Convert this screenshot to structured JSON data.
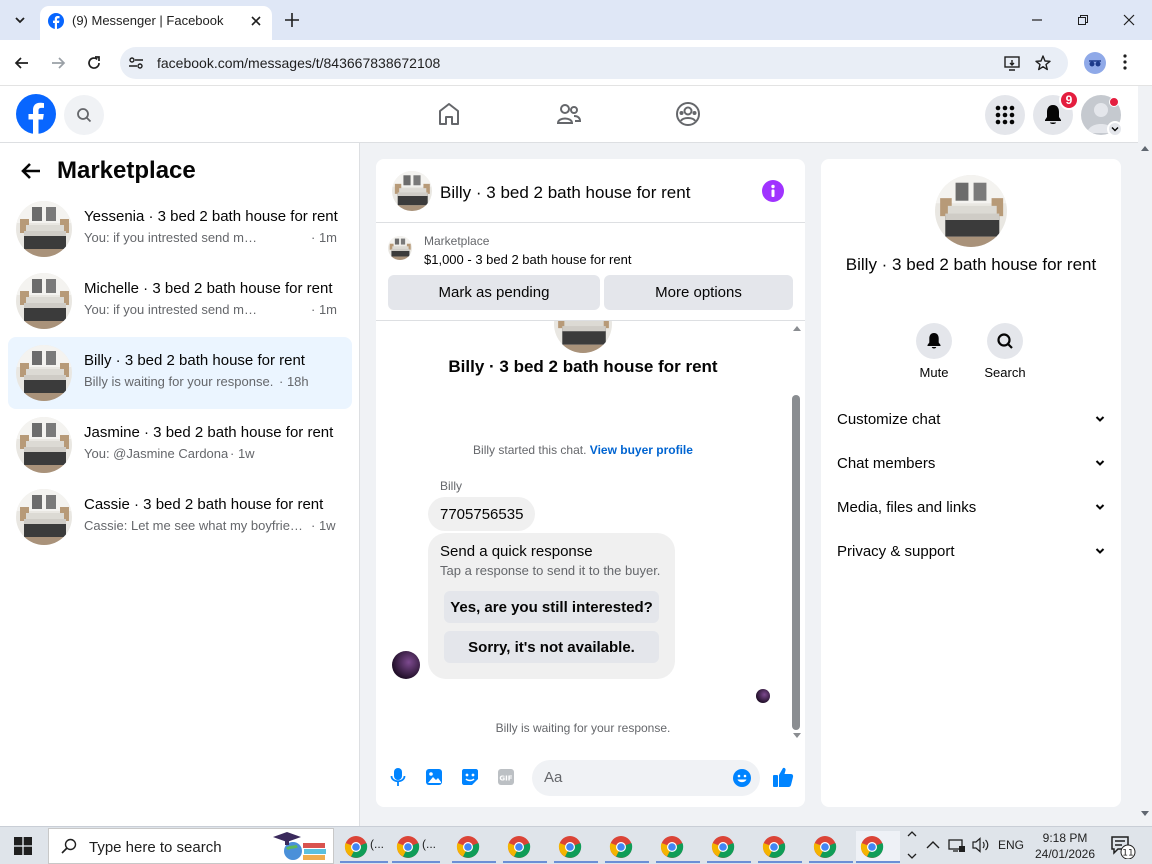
{
  "browser": {
    "tab_title": "(9) Messenger | Facebook",
    "url": "facebook.com/messages/t/843667838672108"
  },
  "header": {
    "notification_count": "9",
    "icons": [
      "facebook-logo",
      "search-icon",
      "home-icon",
      "friends-icon",
      "groups-icon",
      "menu-grid-icon",
      "bell-icon",
      "account-avatar"
    ]
  },
  "left_panel": {
    "title": "Marketplace",
    "conversations": [
      {
        "name": "Yessenia · 3 bed 2 bath house for rent",
        "preview": "You: if you intrested send me your contact",
        "time": "· 1m",
        "active": false
      },
      {
        "name": "Michelle · 3 bed 2 bath house for rent",
        "preview": "You: if you intrested send me your contact",
        "time": "· 1m",
        "active": false
      },
      {
        "name": "Billy · 3 bed 2 bath house for rent",
        "preview": "Billy is waiting for your response.",
        "time": "· 18h",
        "active": true
      },
      {
        "name": "Jasmine · 3 bed 2 bath house for rent",
        "preview": "You: @Jasmine Cardona",
        "time": "· 1w",
        "active": false
      },
      {
        "name": "Cassie · 3 bed 2 bath house for rent",
        "preview": "Cassie: Let me see what my boyfriend says",
        "time": "· 1w",
        "active": false
      }
    ]
  },
  "chat": {
    "title": "Billy · 3 bed 2 bath house for rent",
    "listing_category": "Marketplace",
    "listing_price_title": "$1,000 - 3 bed 2 bath house for rent",
    "mark_pending_label": "Mark as pending",
    "more_options_label": "More options",
    "intro_title": "Billy · 3 bed 2 bath house for rent",
    "started_text": "Billy started this chat.",
    "view_profile_link": "View buyer profile",
    "sender_name": "Billy",
    "message_text": "7705756535",
    "quick_title": "Send a quick response",
    "quick_subtitle": "Tap a response to send it to the buyer.",
    "quick_reply_1": "Yes, are you still interested?",
    "quick_reply_2": "Sorry, it's not available.",
    "waiting_text": "Billy is waiting for your response.",
    "composer_placeholder": "Aa"
  },
  "right_panel": {
    "name": "Billy · 3 bed 2 bath house for rent",
    "mute_label": "Mute",
    "search_label": "Search",
    "sections": [
      "Customize chat",
      "Chat members",
      "Media, files and links",
      "Privacy & support"
    ]
  },
  "taskbar": {
    "search_placeholder": "Type here to search",
    "app_label_1": "(...",
    "app_label_2": "(...",
    "language": "ENG",
    "time": "9:18 PM",
    "date": "24/01/2026",
    "notification_count": "11"
  },
  "colors": {
    "facebook_blue": "#0866ff",
    "messenger_accent": "#0084ff",
    "info_purple": "#a033ff",
    "badge_red": "#e41e3f"
  }
}
